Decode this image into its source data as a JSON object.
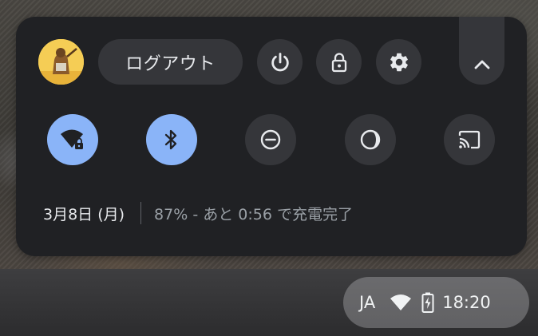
{
  "quick_settings": {
    "logout_label": "ログアウト",
    "date_label": "3月8日 (月)",
    "battery_status": "87% - あと 0:56 で充電完了",
    "feature_toggles": [
      {
        "icon": "wifi-lock-icon",
        "state": "on"
      },
      {
        "icon": "bluetooth-icon",
        "state": "on"
      },
      {
        "icon": "do-not-disturb-icon",
        "state": "off"
      },
      {
        "icon": "night-light-icon",
        "state": "off"
      },
      {
        "icon": "cast-icon",
        "state": "off"
      }
    ],
    "header_buttons": [
      "power-icon",
      "lock-icon",
      "settings-icon",
      "chevron-up-icon"
    ]
  },
  "tray": {
    "ime_label": "JA",
    "time": "18:20",
    "icons": [
      "wifi-icon",
      "battery-charging-icon"
    ]
  },
  "colors": {
    "panel_bg": "#202124",
    "button_bg": "#35363a",
    "accent_on": "#8ab4f8",
    "text_primary": "#e8eaed",
    "text_secondary": "#9aa0a6"
  }
}
